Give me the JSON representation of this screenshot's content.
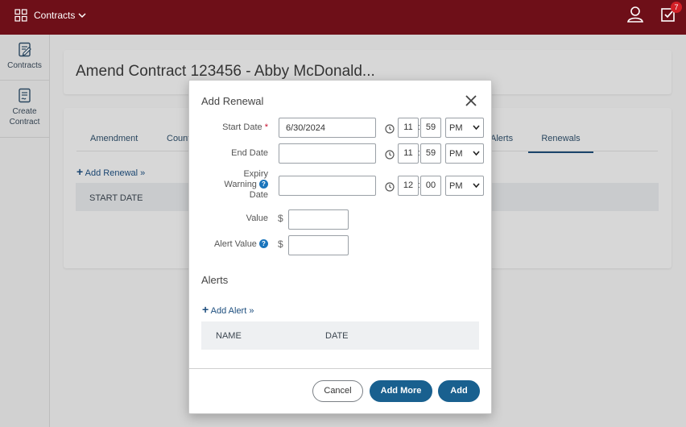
{
  "topbar": {
    "module_label": "Contracts",
    "task_count": "7",
    "colors": {
      "background": "#6e0f18",
      "badge": "#d21f26"
    },
    "icons": [
      "apps-grid-icon",
      "chevron-down-icon",
      "user-icon",
      "tasks-checkbox-icon"
    ]
  },
  "sidebar": {
    "items": [
      {
        "label": "Contracts",
        "icon": "contract-icon"
      },
      {
        "label_line1": "Create",
        "label_line2": "Contract",
        "icon": "create-contract-icon"
      }
    ]
  },
  "page": {
    "title": "Amend Contract 123456 - Abby McDonald...",
    "tabs": [
      {
        "label": "Amendment",
        "active": false
      },
      {
        "label": "Count",
        "active": false
      },
      {
        "label": "Alerts",
        "active": false
      },
      {
        "label": "Renewals",
        "active": true
      }
    ],
    "add_renewal": "Add Renewal »",
    "table_header": "START DATE"
  },
  "modal": {
    "title": "Add Renewal",
    "start_date": {
      "label": "Start Date",
      "required_mark": "*",
      "value": "6/30/2024",
      "hour": "11",
      "minute": "59",
      "ampm": "PM"
    },
    "end_date": {
      "label": "End Date",
      "value": "",
      "hour": "11",
      "minute": "59",
      "ampm": "PM"
    },
    "expiry": {
      "label_line1": "Expiry",
      "label_line2": "Warning",
      "label_line3": "Date",
      "value": "",
      "hour": "12",
      "minute": "00",
      "ampm": "PM"
    },
    "value": {
      "label": "Value",
      "currency": "$",
      "value": ""
    },
    "alert_value": {
      "label": "Alert Value",
      "currency": "$",
      "value": ""
    },
    "help_glyph": "?",
    "alerts_heading": "Alerts",
    "add_alert": "Add Alert »",
    "alerts_table": {
      "columns": [
        "NAME",
        "DATE"
      ]
    },
    "buttons": {
      "cancel": "Cancel",
      "add_more": "Add More",
      "add": "Add"
    },
    "colors": {
      "primary": "#19608f",
      "required": "#c8102e",
      "help": "#1b75bc"
    }
  }
}
